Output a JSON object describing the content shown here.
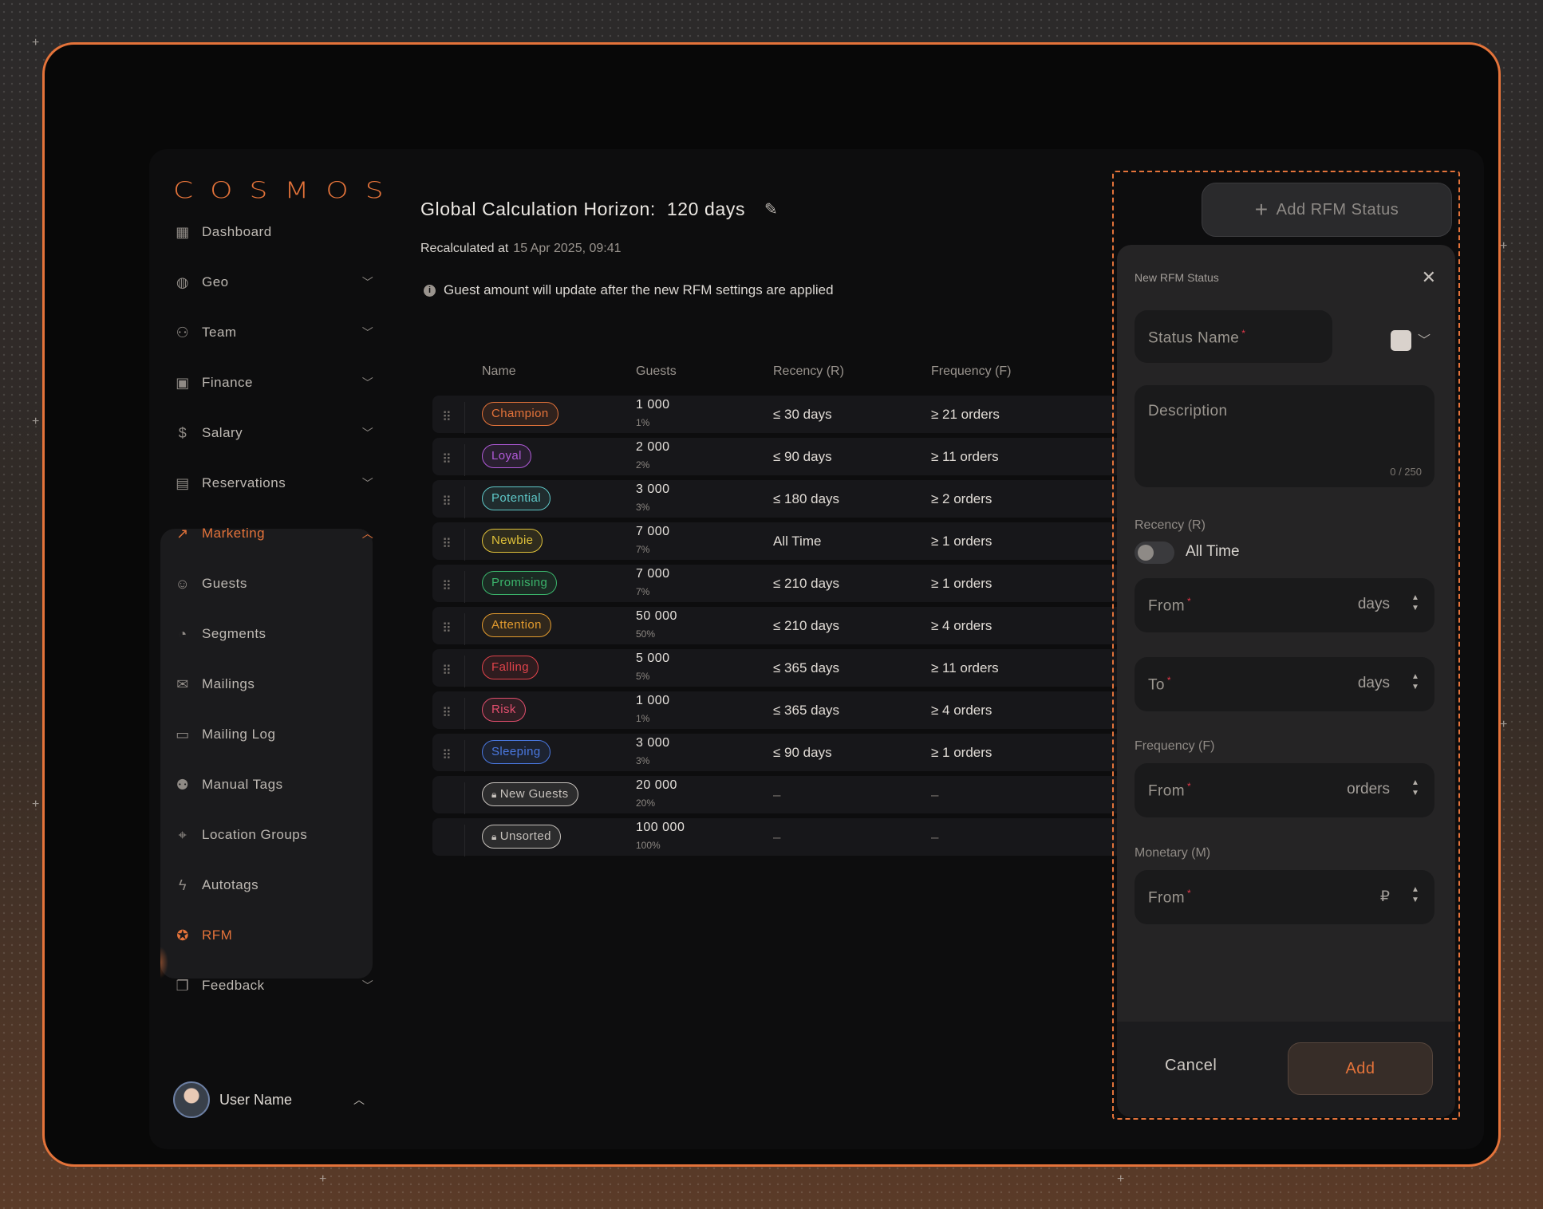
{
  "brand": "COSMOS",
  "nav": [
    {
      "label": "Dashboard",
      "icon": "dashboard-icon",
      "chevron": false
    },
    {
      "label": "Geo",
      "icon": "globe-icon",
      "chevron": true
    },
    {
      "label": "Team",
      "icon": "team-icon",
      "chevron": true
    },
    {
      "label": "Finance",
      "icon": "money-icon",
      "chevron": true
    },
    {
      "label": "Salary",
      "icon": "dollar-icon",
      "chevron": true
    },
    {
      "label": "Reservations",
      "icon": "calendar-icon",
      "chevron": true
    },
    {
      "label": "Marketing",
      "icon": "chart-icon",
      "chevron": true,
      "expanded": true
    },
    {
      "label": "Guests",
      "icon": "smile-icon"
    },
    {
      "label": "Segments",
      "icon": "pie-icon"
    },
    {
      "label": "Mailings",
      "icon": "mail-icon"
    },
    {
      "label": "Mailing Log",
      "icon": "chat-icon"
    },
    {
      "label": "Manual Tags",
      "icon": "user-tag-icon"
    },
    {
      "label": "Location Groups",
      "icon": "location-icon"
    },
    {
      "label": "Autotags",
      "icon": "bolt-icon"
    },
    {
      "label": "RFM",
      "icon": "rfm-badge-icon",
      "active": true
    },
    {
      "label": "Feedback",
      "icon": "feedback-icon",
      "chevron": true
    }
  ],
  "user": {
    "name": "User Name"
  },
  "header": {
    "title_label": "Global Calculation Horizon:",
    "title_value": "120 days",
    "recalc_label": "Recalculated at",
    "recalc_value": "15 Apr 2025, 09:41",
    "note": "Guest amount will update after the new RFM settings are applied"
  },
  "table": {
    "columns": [
      "Name",
      "Guests",
      "Recency (R)",
      "Frequency (F)"
    ],
    "rows": [
      {
        "name": "Champion",
        "color": "#e4733a",
        "guests": "1 000",
        "pct": "1%",
        "recency": "≤ 30 days",
        "frequency": "≥ 21 orders"
      },
      {
        "name": "Loyal",
        "color": "#b05ad8",
        "guests": "2 000",
        "pct": "2%",
        "recency": "≤ 90 days",
        "frequency": "≥ 11 orders"
      },
      {
        "name": "Potential",
        "color": "#5fc9c9",
        "guests": "3 000",
        "pct": "3%",
        "recency": "≤ 180 days",
        "frequency": "≥ 2 orders"
      },
      {
        "name": "Newbie",
        "color": "#e0c23a",
        "guests": "7 000",
        "pct": "7%",
        "recency": "All Time",
        "frequency": "≥ 1 orders"
      },
      {
        "name": "Promising",
        "color": "#3bb56c",
        "guests": "7 000",
        "pct": "7%",
        "recency": "≤ 210 days",
        "frequency": "≥ 1 orders"
      },
      {
        "name": "Attention",
        "color": "#e39b2e",
        "guests": "50 000",
        "pct": "50%",
        "recency": "≤ 210 days",
        "frequency": "≥ 4 orders"
      },
      {
        "name": "Falling",
        "color": "#e0434b",
        "guests": "5 000",
        "pct": "5%",
        "recency": "≤ 365 days",
        "frequency": "≥ 11 orders"
      },
      {
        "name": "Risk",
        "color": "#e24f6e",
        "guests": "1 000",
        "pct": "1%",
        "recency": "≤ 365 days",
        "frequency": "≥ 4 orders"
      },
      {
        "name": "Sleeping",
        "color": "#4a78e0",
        "guests": "3 000",
        "pct": "3%",
        "recency": "≤ 90 days",
        "frequency": "≥ 1 orders"
      },
      {
        "name": "New Guests",
        "color": "#c7c2bd",
        "guests": "20 000",
        "pct": "20%",
        "recency": "–",
        "frequency": "–",
        "locked": true
      },
      {
        "name": "Unsorted",
        "color": "#c7c2bd",
        "guests": "100 000",
        "pct": "100%",
        "recency": "–",
        "frequency": "–",
        "locked": true
      }
    ]
  },
  "panel": {
    "add_status_label": "Add RFM Status",
    "title": "New RFM Status",
    "status_name_placeholder": "Status Name",
    "description_placeholder": "Description",
    "description_counter": "0 / 250",
    "recency_label": "Recency (R)",
    "all_time_label": "All Time",
    "recency_from": "From",
    "recency_to": "To",
    "days_unit": "days",
    "frequency_label": "Frequency (F)",
    "frequency_from": "From",
    "orders_unit": "orders",
    "monetary_label": "Monetary (M)",
    "monetary_from": "From",
    "currency_unit": "₽",
    "cancel_label": "Cancel",
    "add_label": "Add"
  }
}
